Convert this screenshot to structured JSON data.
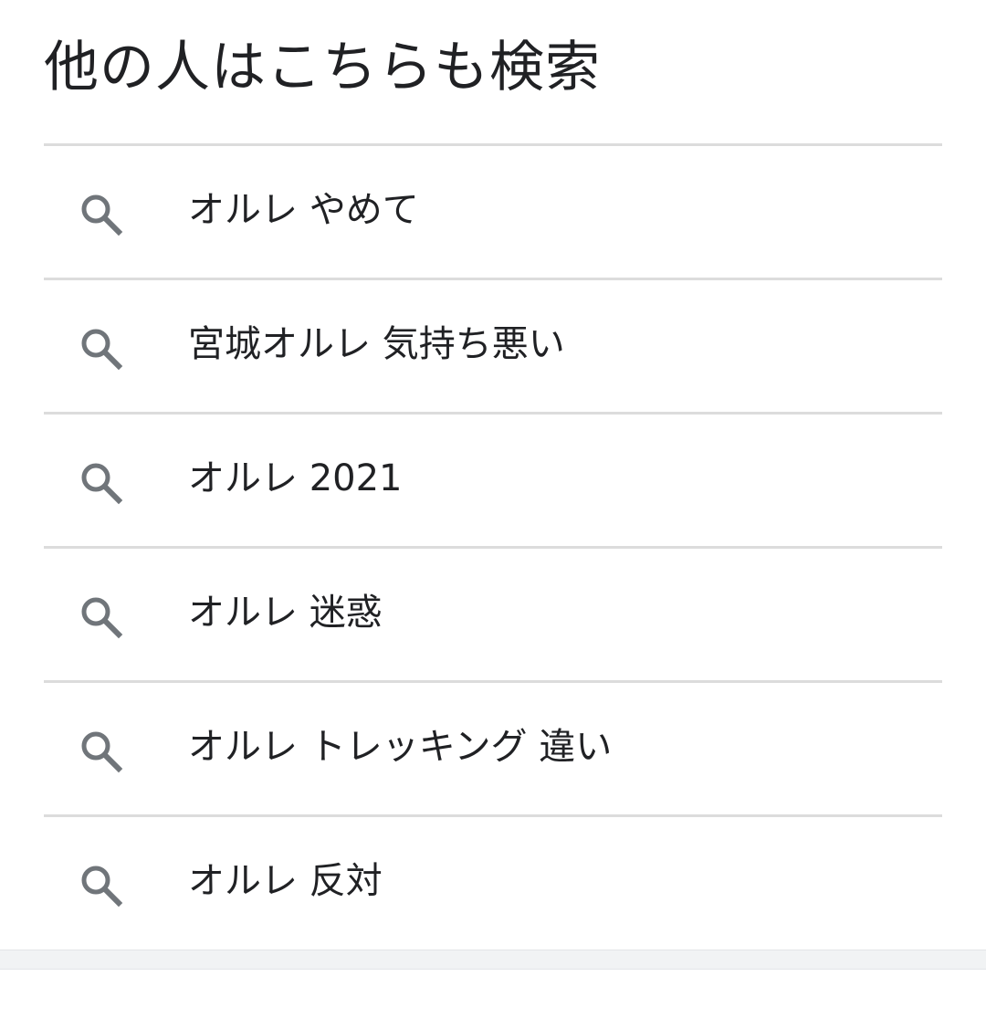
{
  "section": {
    "title": "他の人はこちらも検索"
  },
  "related_searches": [
    {
      "label": "オルレ やめて",
      "icon": "search-icon"
    },
    {
      "label": "宮城オルレ 気持ち悪い",
      "icon": "search-icon"
    },
    {
      "label": "オルレ 2021",
      "icon": "search-icon"
    },
    {
      "label": "オルレ 迷惑",
      "icon": "search-icon"
    },
    {
      "label": "オルレ トレッキング 違い",
      "icon": "search-icon"
    },
    {
      "label": "オルレ 反対",
      "icon": "search-icon"
    }
  ],
  "colors": {
    "text": "#202124",
    "icon": "#70757a",
    "divider": "#dcdcdc",
    "footer": "#f1f3f4"
  }
}
